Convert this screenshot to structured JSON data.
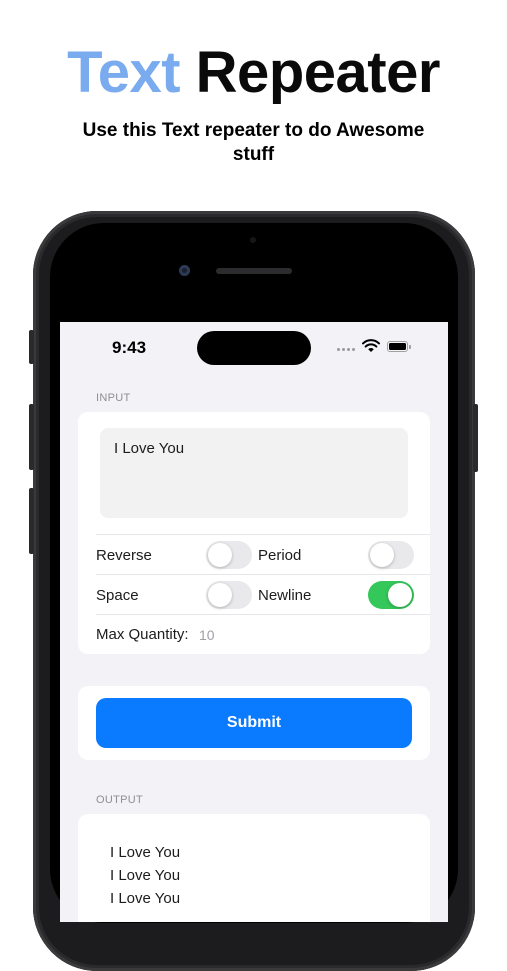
{
  "hero": {
    "title_accent": "Text",
    "title_rest": "Repeater",
    "subtitle": "Use this Text repeater to do Awesome stuff"
  },
  "status_bar": {
    "time": "9:43"
  },
  "input_section": {
    "label": "INPUT",
    "text_value": "I Love You"
  },
  "options": {
    "reverse": {
      "label": "Reverse",
      "on": false
    },
    "period": {
      "label": "Period",
      "on": false
    },
    "space": {
      "label": "Space",
      "on": false
    },
    "newline": {
      "label": "Newline",
      "on": true
    }
  },
  "max_quantity": {
    "label": "Max Quantity:",
    "value": "10"
  },
  "submit": {
    "label": "Submit"
  },
  "output_section": {
    "label": "OUTPUT",
    "lines": [
      "I Love You",
      "I Love You",
      "I Love You"
    ]
  },
  "colors": {
    "title_accent": "#7aabef",
    "submit_button": "#0a7aff",
    "toggle_on": "#34c759"
  }
}
